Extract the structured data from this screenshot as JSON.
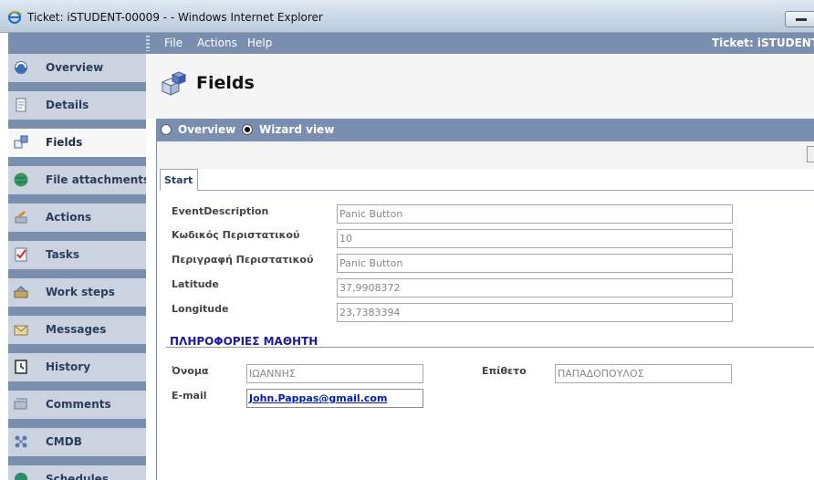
{
  "window": {
    "title": "Ticket: iSTUDENT-00009 - - Windows Internet Explorer"
  },
  "menubar": {
    "items": [
      "File",
      "Actions",
      "Help"
    ],
    "app_title": "Ticket: iSTUDENT"
  },
  "sidebar": {
    "items": [
      {
        "label": "Overview",
        "icon": "overview-icon"
      },
      {
        "label": "Details",
        "icon": "details-icon"
      },
      {
        "label": "Fields",
        "icon": "fields-icon",
        "active": true
      },
      {
        "label": "File attachments",
        "icon": "globe-icon"
      },
      {
        "label": "Actions",
        "icon": "actions-icon"
      },
      {
        "label": "Tasks",
        "icon": "tasks-icon"
      },
      {
        "label": "Work steps",
        "icon": "work-steps-icon"
      },
      {
        "label": "Messages",
        "icon": "messages-icon"
      },
      {
        "label": "History",
        "icon": "history-icon"
      },
      {
        "label": "Comments",
        "icon": "comments-icon"
      },
      {
        "label": "CMDB",
        "icon": "cmdb-icon"
      },
      {
        "label": "Schedules",
        "icon": "schedules-icon"
      }
    ]
  },
  "page": {
    "title": "Fields"
  },
  "viewbar": {
    "overview_label": "Overview",
    "wizard_label": "Wizard view",
    "selected": "Wizard view"
  },
  "tabs": {
    "start_label": "Start"
  },
  "fields": {
    "event_description": {
      "label": "EventDescription",
      "value": "Panic Button"
    },
    "incident_code": {
      "label": "Κωδικός Περιστατικού",
      "value": "10"
    },
    "incident_description": {
      "label": "Περιγραφή Περιστατικού",
      "value": "Panic Button"
    },
    "latitude": {
      "label": "Latitude",
      "value": "37,9908372"
    },
    "longitude": {
      "label": "Longitude",
      "value": "23,7383394"
    }
  },
  "student_section": {
    "title": "ΠΛΗΡΟΦΟΡΙΕΣ ΜΑΘΗΤΗ",
    "first_name": {
      "label": "Όνομα",
      "value": "ΙΩΑΝΝΗΣ"
    },
    "last_name": {
      "label": "Επίθετο",
      "value": "ΠΑΠΑΔΟΠΟΥΛΟΣ"
    },
    "email": {
      "label": "E-mail",
      "value": "John.Pappas@gmail.com"
    }
  },
  "colors": {
    "nav_blue": "#7a8fb0",
    "sidebar_bg": "#ccd3e0",
    "section_title": "#1a1aa0",
    "link": "#0a1aa8"
  }
}
